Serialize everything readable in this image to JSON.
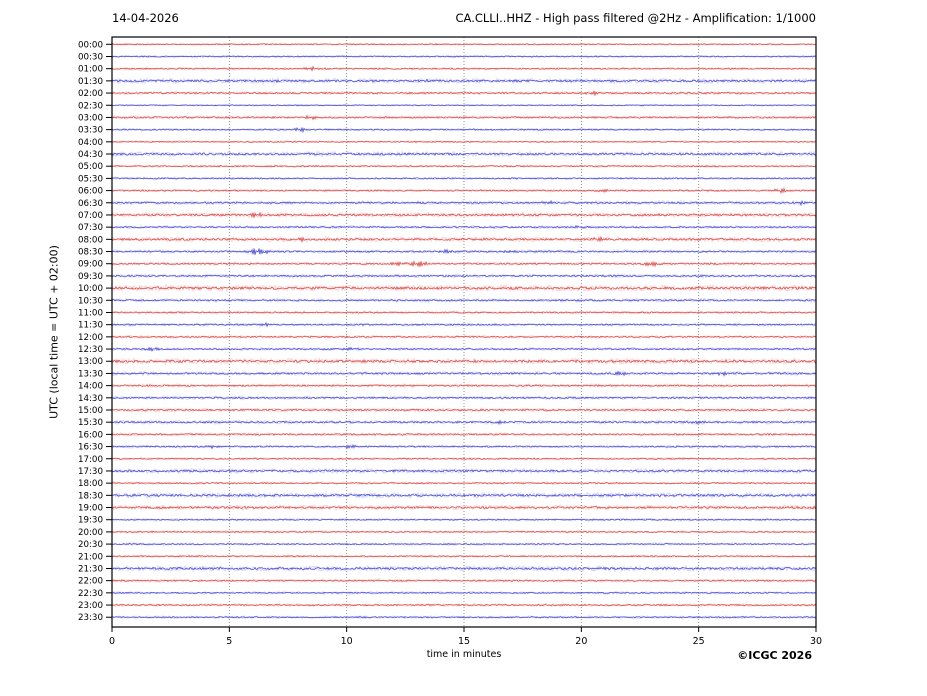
{
  "header": {
    "date": "14-04-2026",
    "title": "CA.CLLI..HHZ - High pass filtered @2Hz - Amplification: 1/1000"
  },
  "footer": {
    "copyright": "©ICGC 2026"
  },
  "chart_data": {
    "type": "line",
    "subtype": "helicorder-day-plot",
    "title": "CA.CLLI..HHZ - High pass filtered @2Hz - Amplification: 1/1000",
    "date": "14-04-2026",
    "station": "CA.CLLI..HHZ",
    "filter": "High pass filtered @2Hz",
    "amplification": "1/1000",
    "xlabel": "time in minutes",
    "ylabel": "UTC (local time = UTC + 02:00)",
    "xlim": [
      0,
      30
    ],
    "x_ticks": [
      0,
      5,
      10,
      15,
      20,
      25,
      30
    ],
    "x_gridlines": [
      5,
      10,
      15,
      20,
      25
    ],
    "grid_style": "vertical dotted",
    "row_interval_minutes": 30,
    "trace_colors": {
      "red": "#d93a3a",
      "blue": "#3b3bd0"
    },
    "frame_color": "#000000",
    "events_format": "[minute_position, relative_amplitude]",
    "rows": [
      {
        "label": "00:00",
        "color": "red",
        "noise": 0.6,
        "events": []
      },
      {
        "label": "00:30",
        "color": "blue",
        "noise": 0.6,
        "events": []
      },
      {
        "label": "01:00",
        "color": "red",
        "noise": 0.7,
        "events": [
          [
            8.5,
            1.6
          ]
        ]
      },
      {
        "label": "01:30",
        "color": "blue",
        "noise": 1.2,
        "events": [
          [
            7.0,
            1.1
          ],
          [
            13.4,
            1.1
          ]
        ]
      },
      {
        "label": "02:00",
        "color": "red",
        "noise": 0.9,
        "events": [
          [
            20.5,
            1.4
          ]
        ]
      },
      {
        "label": "02:30",
        "color": "blue",
        "noise": 0.5,
        "events": []
      },
      {
        "label": "03:00",
        "color": "red",
        "noise": 0.9,
        "events": [
          [
            8.5,
            1.4
          ]
        ]
      },
      {
        "label": "03:30",
        "color": "blue",
        "noise": 0.7,
        "events": [
          [
            8.0,
            1.6
          ]
        ]
      },
      {
        "label": "04:00",
        "color": "red",
        "noise": 0.6,
        "events": []
      },
      {
        "label": "04:30",
        "color": "blue",
        "noise": 1.2,
        "events": []
      },
      {
        "label": "05:00",
        "color": "red",
        "noise": 0.7,
        "events": []
      },
      {
        "label": "05:30",
        "color": "blue",
        "noise": 0.7,
        "events": []
      },
      {
        "label": "06:00",
        "color": "red",
        "noise": 0.8,
        "events": [
          [
            20.9,
            1.6
          ],
          [
            28.5,
            2.0
          ]
        ]
      },
      {
        "label": "06:30",
        "color": "blue",
        "noise": 1.0,
        "events": [
          [
            18.5,
            1.2
          ],
          [
            29.4,
            1.5
          ]
        ]
      },
      {
        "label": "07:00",
        "color": "red",
        "noise": 1.2,
        "events": [
          [
            6.1,
            2.0
          ]
        ]
      },
      {
        "label": "07:30",
        "color": "blue",
        "noise": 0.8,
        "events": [
          [
            20.0,
            1.4
          ]
        ]
      },
      {
        "label": "08:00",
        "color": "red",
        "noise": 1.2,
        "events": [
          [
            8.0,
            1.5
          ],
          [
            20.8,
            1.7
          ]
        ]
      },
      {
        "label": "08:30",
        "color": "blue",
        "noise": 0.9,
        "events": [
          [
            6.2,
            3.0
          ],
          [
            14.2,
            1.7
          ],
          [
            17.0,
            1.2
          ]
        ]
      },
      {
        "label": "09:00",
        "color": "red",
        "noise": 0.9,
        "events": [
          [
            12.2,
            1.7
          ],
          [
            13.1,
            2.4
          ],
          [
            23.0,
            2.2
          ]
        ]
      },
      {
        "label": "09:30",
        "color": "blue",
        "noise": 0.9,
        "events": []
      },
      {
        "label": "10:00",
        "color": "red",
        "noise": 1.5,
        "events": []
      },
      {
        "label": "10:30",
        "color": "blue",
        "noise": 0.9,
        "events": []
      },
      {
        "label": "11:00",
        "color": "red",
        "noise": 0.8,
        "events": []
      },
      {
        "label": "11:30",
        "color": "blue",
        "noise": 0.8,
        "events": [
          [
            6.5,
            1.2
          ]
        ]
      },
      {
        "label": "12:00",
        "color": "red",
        "noise": 0.8,
        "events": []
      },
      {
        "label": "12:30",
        "color": "blue",
        "noise": 0.8,
        "events": [
          [
            1.7,
            1.8
          ],
          [
            10.1,
            1.7
          ]
        ]
      },
      {
        "label": "13:00",
        "color": "red",
        "noise": 1.5,
        "events": []
      },
      {
        "label": "13:30",
        "color": "blue",
        "noise": 1.0,
        "events": [
          [
            21.7,
            1.4
          ],
          [
            26.0,
            1.3
          ]
        ]
      },
      {
        "label": "14:00",
        "color": "red",
        "noise": 0.9,
        "events": []
      },
      {
        "label": "14:30",
        "color": "blue",
        "noise": 0.9,
        "events": []
      },
      {
        "label": "15:00",
        "color": "red",
        "noise": 1.0,
        "events": []
      },
      {
        "label": "15:30",
        "color": "blue",
        "noise": 1.0,
        "events": [
          [
            16.5,
            1.2
          ],
          [
            25.0,
            1.2
          ]
        ]
      },
      {
        "label": "16:00",
        "color": "red",
        "noise": 0.9,
        "events": []
      },
      {
        "label": "16:30",
        "color": "blue",
        "noise": 0.8,
        "events": [
          [
            4.3,
            1.5
          ],
          [
            10.2,
            1.4
          ]
        ]
      },
      {
        "label": "17:00",
        "color": "red",
        "noise": 0.7,
        "events": []
      },
      {
        "label": "17:30",
        "color": "blue",
        "noise": 1.2,
        "events": []
      },
      {
        "label": "18:00",
        "color": "red",
        "noise": 0.7,
        "events": []
      },
      {
        "label": "18:30",
        "color": "blue",
        "noise": 1.3,
        "events": []
      },
      {
        "label": "19:00",
        "color": "red",
        "noise": 1.2,
        "events": []
      },
      {
        "label": "19:30",
        "color": "blue",
        "noise": 0.7,
        "events": []
      },
      {
        "label": "20:00",
        "color": "red",
        "noise": 0.7,
        "events": []
      },
      {
        "label": "20:30",
        "color": "blue",
        "noise": 0.7,
        "events": []
      },
      {
        "label": "21:00",
        "color": "red",
        "noise": 0.7,
        "events": []
      },
      {
        "label": "21:30",
        "color": "blue",
        "noise": 1.3,
        "events": [
          [
            0.3,
            1.1
          ]
        ]
      },
      {
        "label": "22:00",
        "color": "red",
        "noise": 0.8,
        "events": []
      },
      {
        "label": "22:30",
        "color": "blue",
        "noise": 0.7,
        "events": []
      },
      {
        "label": "23:00",
        "color": "red",
        "noise": 0.8,
        "events": []
      },
      {
        "label": "23:30",
        "color": "blue",
        "noise": 0.7,
        "events": []
      }
    ]
  }
}
